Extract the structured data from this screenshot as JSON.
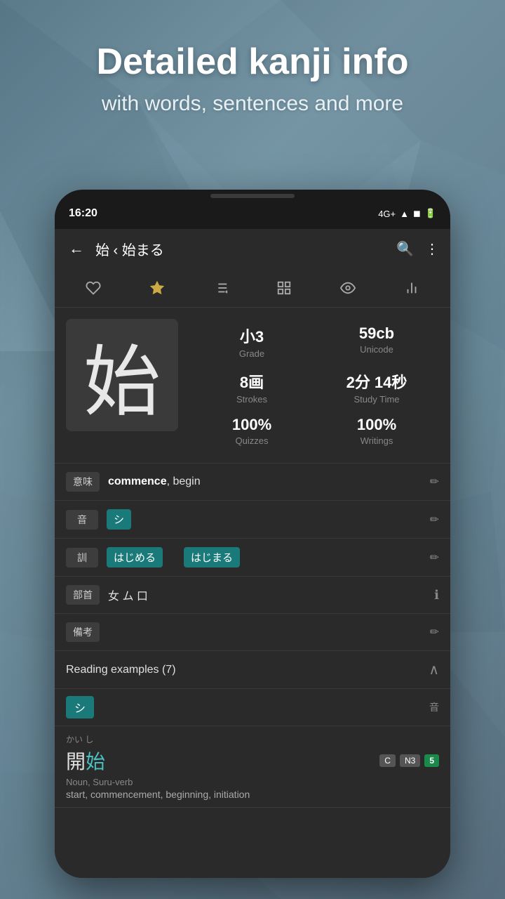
{
  "background": {
    "color": "#6b8a9a"
  },
  "promo": {
    "title": "Detailed kanji info",
    "subtitle": "with words, sentences and more"
  },
  "status_bar": {
    "time": "16:20",
    "network": "4G+",
    "battery": "▐"
  },
  "top_bar": {
    "title": "始 ‹ 始まる",
    "back_icon": "←",
    "search_icon": "🔍",
    "more_icon": "⋮"
  },
  "toolbar": {
    "heart_icon": "♡",
    "star_icon": "★",
    "add_list_icon": "≡+",
    "grid_icon": "⊞",
    "eye_icon": "👁",
    "chart_icon": "📊"
  },
  "kanji": {
    "character": "始",
    "grade_value": "小3",
    "grade_label": "Grade",
    "unicode_value": "59cb",
    "unicode_label": "Unicode",
    "strokes_value": "8画",
    "strokes_label": "Strokes",
    "study_time_value": "2分 14秒",
    "study_time_label": "Study Time",
    "quizzes_value": "100%",
    "quizzes_label": "Quizzes",
    "writings_value": "100%",
    "writings_label": "Writings"
  },
  "info_rows": {
    "meaning": {
      "tag": "意味",
      "content": "commence, begin"
    },
    "on_reading": {
      "tag": "音",
      "reading": "シ"
    },
    "kun_reading": {
      "tag": "訓",
      "readings": [
        "はじめる",
        "はじまる"
      ]
    },
    "bushu": {
      "tag": "部首",
      "content": "女 ム 口"
    },
    "notes": {
      "tag": "備考"
    }
  },
  "reading_examples": {
    "title": "Reading examples (7)",
    "groups": [
      {
        "kana": "シ",
        "type_label": "音"
      }
    ],
    "words": [
      {
        "furigana": "かい し",
        "kanji_prefix": "開",
        "kanji_highlight": "始",
        "badge_c": "C",
        "badge_n": "N3",
        "badge_level": "5",
        "word_type": "Noun, Suru-verb",
        "meaning": "start, commencement, beginning, initiation"
      }
    ]
  }
}
